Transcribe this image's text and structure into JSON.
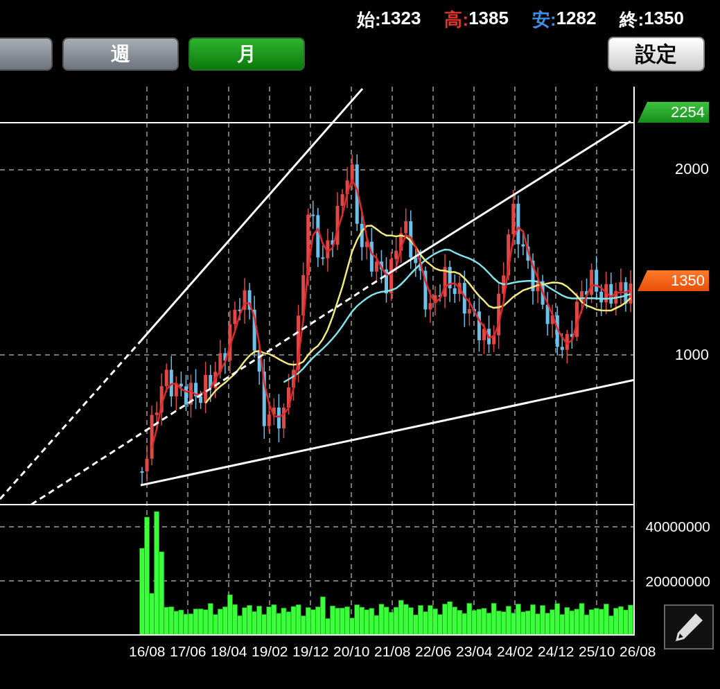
{
  "ohlc": [
    {
      "label": "始:",
      "value": "1323",
      "color": "#ffffff"
    },
    {
      "label": "高:",
      "value": "1385",
      "color": "#e8352a"
    },
    {
      "label": "安:",
      "value": "1282",
      "color": "#3d8fe8"
    },
    {
      "label": "終:",
      "value": "1350",
      "color": "#ffffff"
    }
  ],
  "periods": [
    {
      "selected": false
    },
    {
      "label": "週",
      "selected": false
    },
    {
      "label": "月",
      "selected": true
    }
  ],
  "settings_button": "設定",
  "price_axis": [
    {
      "label": "2254",
      "kind": "high-flag"
    },
    {
      "label": "2000",
      "kind": "tick"
    },
    {
      "label": "1350",
      "kind": "last-flag"
    },
    {
      "label": "1000",
      "kind": "tick"
    }
  ],
  "volume_axis": [
    "40000000",
    "20000000"
  ],
  "date_axis": [
    "16/08",
    "17/06",
    "18/04",
    "19/02",
    "19/12",
    "20/10",
    "21/08",
    "22/06",
    "23/04",
    "24/02",
    "24/12",
    "25/10",
    "26/08"
  ]
}
